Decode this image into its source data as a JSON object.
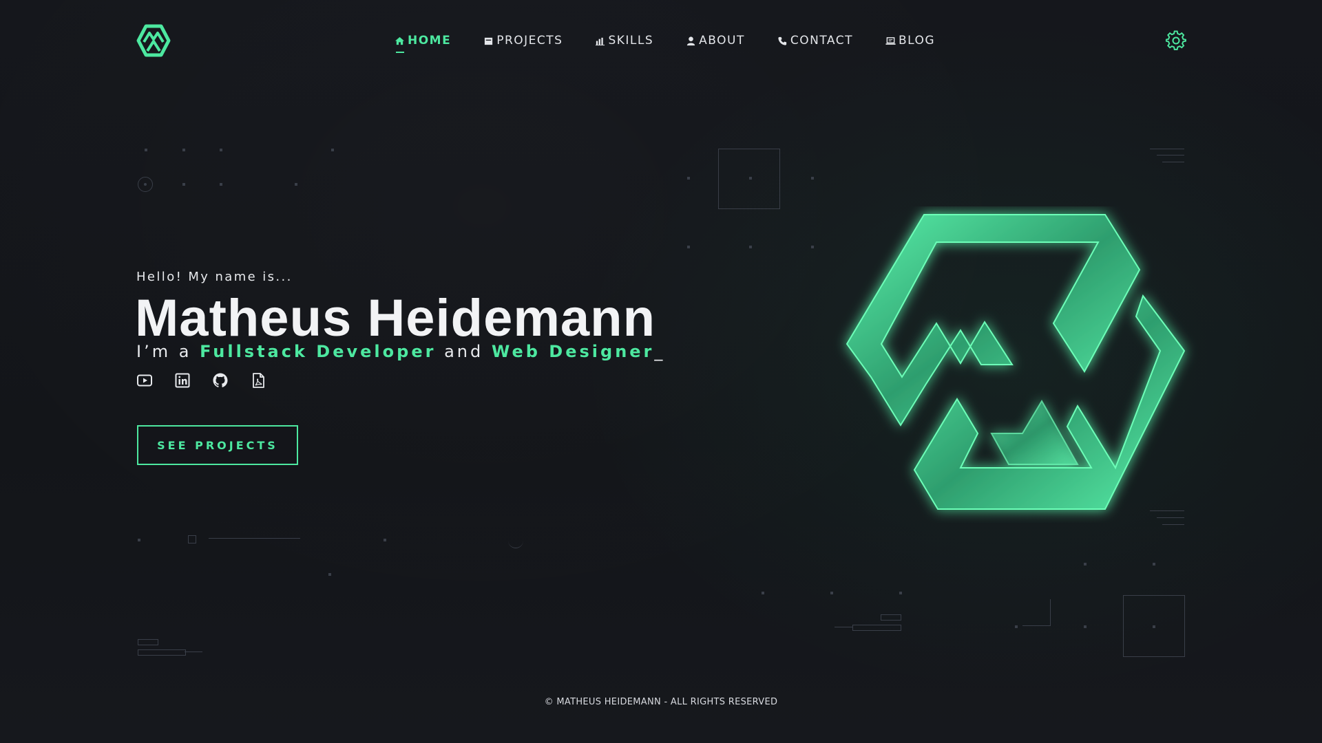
{
  "header": {
    "logo_icon": "mh-hexagon-logo",
    "nav": [
      {
        "label": "HOME",
        "icon": "home-icon",
        "active": true
      },
      {
        "label": "PROJECTS",
        "icon": "folder-icon",
        "active": false
      },
      {
        "label": "SKILLS",
        "icon": "bar-chart-icon",
        "active": false
      },
      {
        "label": "ABOUT",
        "icon": "user-icon",
        "active": false
      },
      {
        "label": "CONTACT",
        "icon": "phone-icon",
        "active": false
      },
      {
        "label": "BLOG",
        "icon": "laptop-icon",
        "active": false
      }
    ],
    "settings_icon": "gear-icon"
  },
  "hero": {
    "greeting": "Hello! My name is...",
    "name": "Matheus Heidemann",
    "tagline_prefix": "I’m a",
    "tagline_role1": "Fullstack Developer",
    "tagline_and": "and",
    "tagline_role2": "Web Designer",
    "tagline_cursor": "_",
    "socials": [
      "youtube-icon",
      "linkedin-icon",
      "github-icon",
      "pdf-resume-icon"
    ],
    "cta_label": "SEE PROJECTS"
  },
  "footer": {
    "copyright": "© MATHEUS HEIDEMANN - ALL RIGHTS RESERVED"
  },
  "colors": {
    "accent": "#4de8a0",
    "background": "#14161b",
    "text": "#e8eaed",
    "decor": "#3a3f49"
  }
}
